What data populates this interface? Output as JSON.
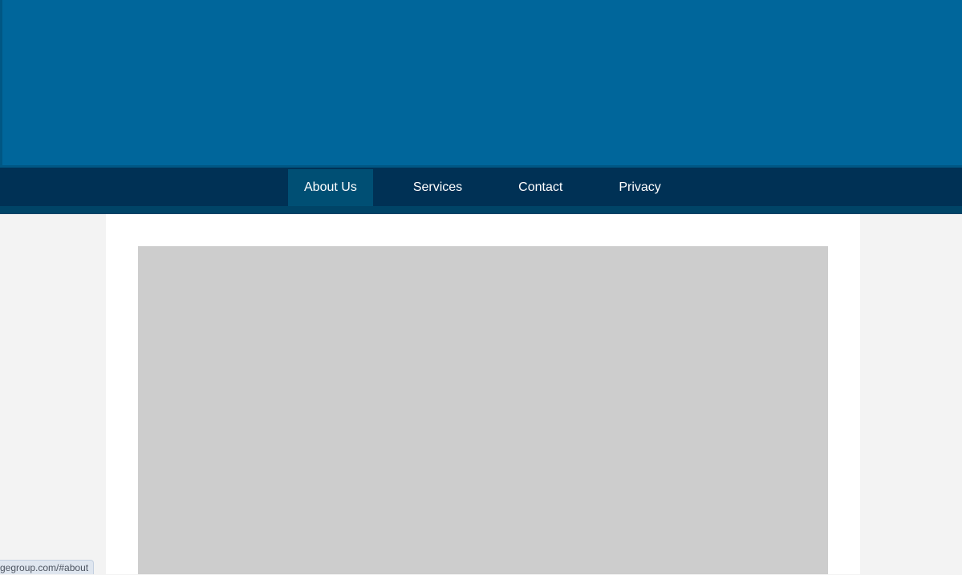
{
  "header": {
    "bg_color": "#00669b"
  },
  "nav": {
    "bg_color": "#003155",
    "active_color": "#004f74",
    "items": [
      {
        "label": "About Us",
        "active": true
      },
      {
        "label": "Services",
        "active": false
      },
      {
        "label": "Contact",
        "active": false
      },
      {
        "label": "Privacy",
        "active": false
      }
    ]
  },
  "content": {
    "placeholder_color": "#cdcdcd"
  },
  "status_bar": {
    "url": "gegroup.com/#about"
  }
}
